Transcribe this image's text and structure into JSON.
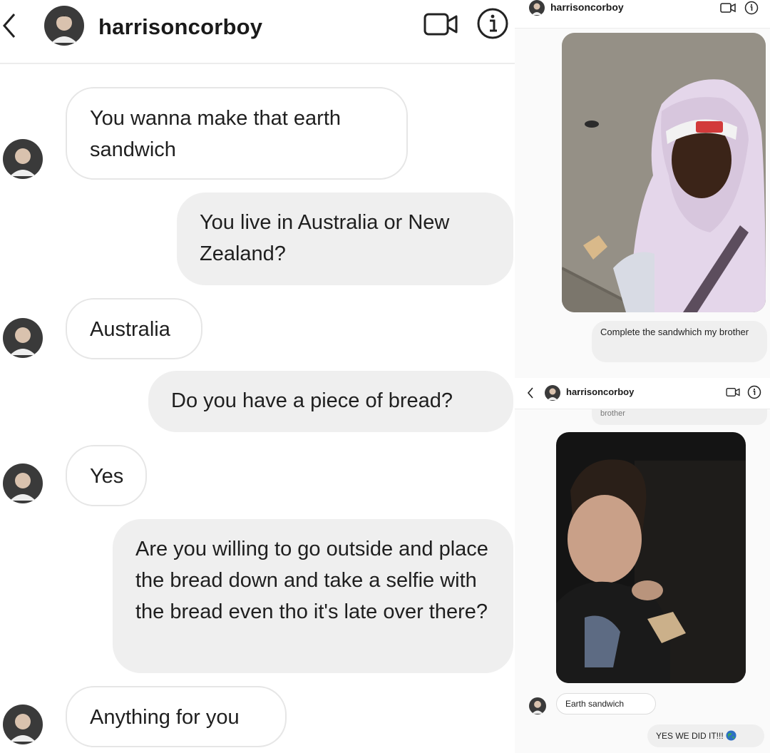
{
  "left": {
    "header": {
      "username": "harrisoncorboy"
    },
    "messages": [
      {
        "text": "You wanna make that earth sandwich"
      },
      {
        "text": "You live in Australia or New Zealand?"
      },
      {
        "text": "Australia"
      },
      {
        "text": "Do you have a piece of bread?"
      },
      {
        "text": "Yes"
      },
      {
        "text": "Are you willing to go outside and place the bread down and take a selfie with the bread even tho it's late over there?"
      },
      {
        "text": "Anything for you"
      }
    ]
  },
  "right_top": {
    "header": {
      "username": "harrisoncorboy"
    },
    "caption": "Complete the sandwhich my brother"
  },
  "right_bottom": {
    "header": {
      "username": "harrisoncorboy"
    },
    "cut_text": "brother",
    "caption": "Earth sandwich",
    "reply": "YES WE DID IT!!!"
  },
  "colors": {
    "incoming_bubble": "#ffffff",
    "outgoing_bubble": "#efefef",
    "hoodie": "#e4d6ea",
    "pavement": "#8f8a80"
  }
}
